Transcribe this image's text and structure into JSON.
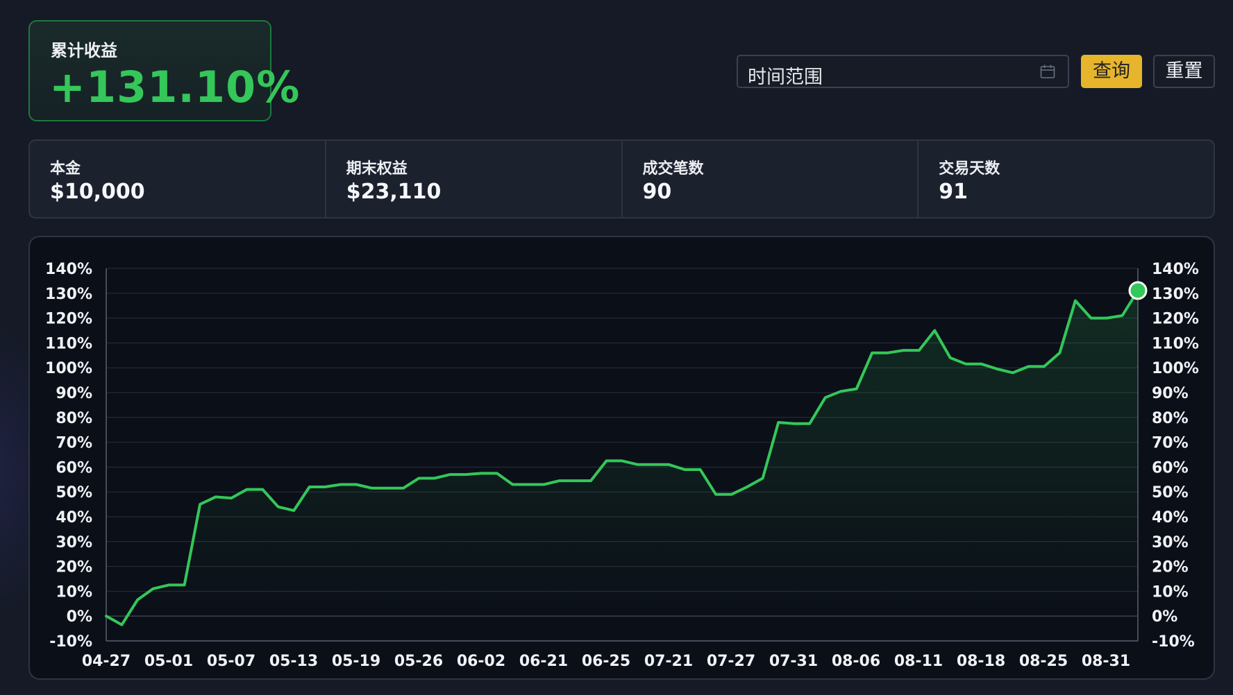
{
  "summary": {
    "label": "累计收益",
    "value": "+131.10%"
  },
  "toolbar": {
    "date_range_placeholder": "时间范围",
    "query_label": "查询",
    "reset_label": "重置"
  },
  "stats": [
    {
      "label": "本金",
      "value": "$10,000"
    },
    {
      "label": "期末权益",
      "value": "$23,110"
    },
    {
      "label": "成交笔数",
      "value": "90"
    },
    {
      "label": "交易天数",
      "value": "91"
    }
  ],
  "colors": {
    "accent_green": "#34c759",
    "query_button": "#e6b52c",
    "background": "#151a26"
  },
  "chart_data": {
    "type": "area",
    "x_tick_labels": [
      "04-27",
      "05-01",
      "05-07",
      "05-13",
      "05-19",
      "05-26",
      "06-02",
      "06-21",
      "06-25",
      "07-21",
      "07-27",
      "07-31",
      "08-06",
      "08-11",
      "08-18",
      "08-25",
      "08-31"
    ],
    "y_tick_labels": [
      "140%",
      "130%",
      "120%",
      "110%",
      "100%",
      "90%",
      "80%",
      "70%",
      "60%",
      "50%",
      "40%",
      "30%",
      "20%",
      "10%",
      "0%",
      "-10%"
    ],
    "ylim": [
      -10,
      140
    ],
    "grid": true,
    "dual_y_axis": true,
    "legend": false,
    "last_point_marker": true,
    "values": [
      0,
      -3.5,
      6.5,
      11,
      12.5,
      12.5,
      45,
      48,
      47.5,
      51,
      51,
      44,
      42.5,
      52,
      52,
      53,
      53,
      51.5,
      51.5,
      51.5,
      55.5,
      55.5,
      57,
      57,
      57.5,
      57.5,
      53,
      53,
      53,
      54.5,
      54.5,
      54.5,
      62.5,
      62.5,
      61,
      61,
      61,
      59,
      59,
      49,
      49,
      52,
      55.5,
      78,
      77.5,
      77.5,
      88,
      90.5,
      91.5,
      106,
      106,
      107,
      107,
      115,
      104,
      101.5,
      101.5,
      99.5,
      98,
      100.5,
      100.5,
      106,
      127,
      120,
      120,
      121,
      131.1
    ]
  }
}
